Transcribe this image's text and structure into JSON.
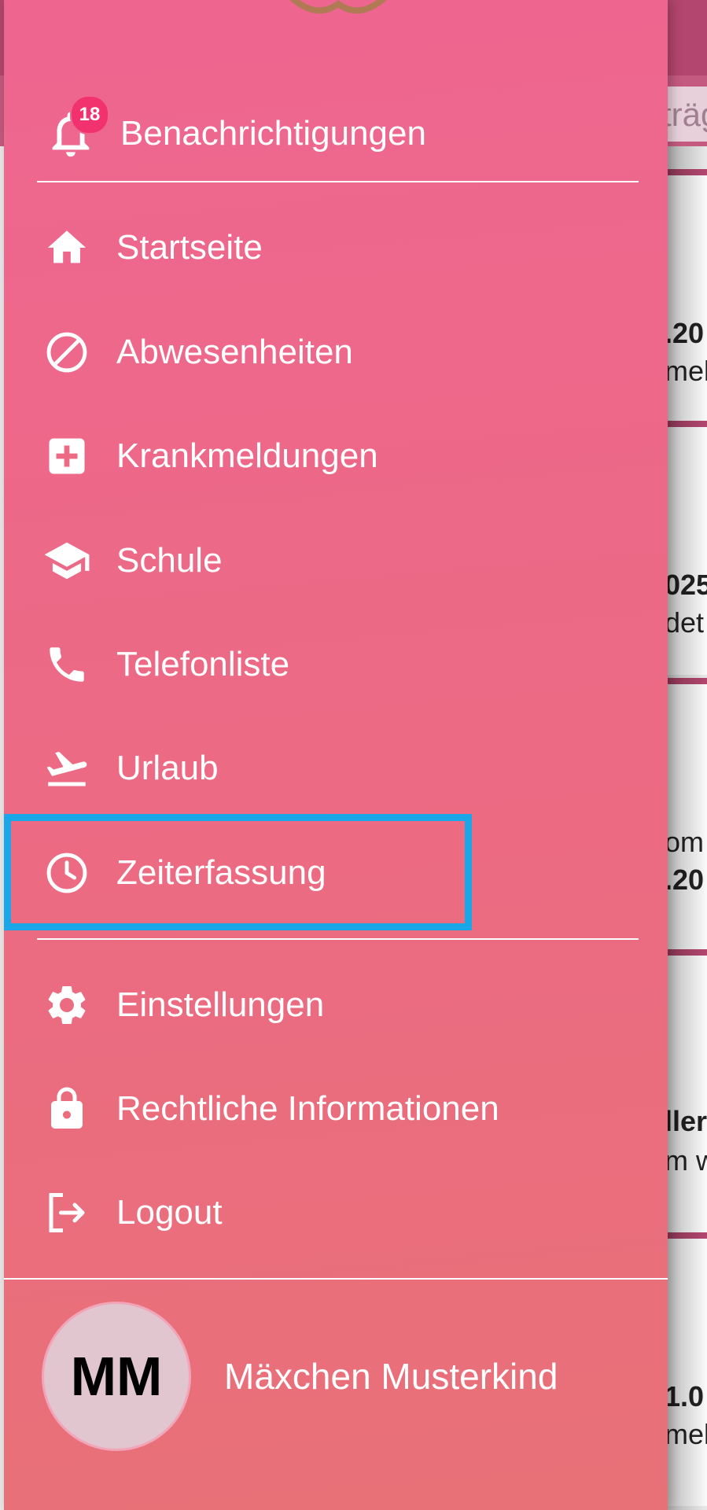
{
  "notifications": {
    "label": "Benachrichtigungen",
    "badge_count": "18"
  },
  "menu": {
    "items": [
      {
        "label": "Startseite",
        "icon": "home-icon"
      },
      {
        "label": "Abwesenheiten",
        "icon": "block-icon"
      },
      {
        "label": "Krankmeldungen",
        "icon": "medical-plus-icon"
      },
      {
        "label": "Schule",
        "icon": "graduation-cap-icon"
      },
      {
        "label": "Telefonliste",
        "icon": "phone-icon"
      },
      {
        "label": "Urlaub",
        "icon": "plane-departure-icon"
      },
      {
        "label": "Zeiterfassung",
        "icon": "clock-icon"
      }
    ],
    "secondary": [
      {
        "label": "Einstellungen",
        "icon": "gear-icon"
      },
      {
        "label": "Rechtliche Informationen",
        "icon": "lock-icon"
      },
      {
        "label": "Logout",
        "icon": "logout-icon"
      }
    ]
  },
  "profile": {
    "initials": "MM",
    "name": "Mäxchen Musterkind"
  },
  "background": {
    "search_fragment": "träg",
    "card_fragments": [
      {
        "line1": ".20",
        "line2": "meld"
      },
      {
        "line1": "025",
        "line2": "det"
      },
      {
        "line1": "om",
        "line2": ".20"
      },
      {
        "line1": "ller",
        "line2": "m w"
      },
      {
        "line1": "1.0",
        "line2": "meld"
      }
    ]
  },
  "colors": {
    "drawer_top": "#ee6690",
    "drawer_bottom": "#e87177",
    "badge": "#f2316f",
    "highlight": "#1aa7e8",
    "accent_dark": "#b3466e"
  }
}
